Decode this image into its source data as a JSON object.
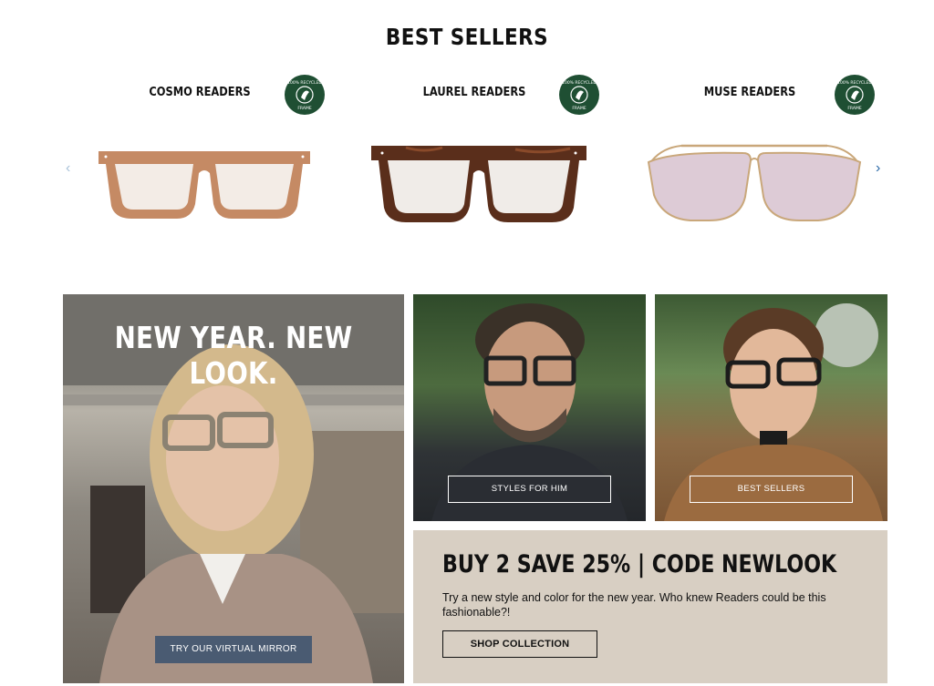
{
  "section": {
    "title": "BEST SELLERS"
  },
  "carousel": {
    "products": [
      {
        "name": "COSMO READERS",
        "badge": "100% RECYCLED FRAME",
        "frame_color": "#c58a64",
        "lens_color": "#f3ece6"
      },
      {
        "name": "LAUREL READERS",
        "badge": "100% RECYCLED FRAME",
        "frame_color": "#5a2e1b",
        "lens_color": "#f0ece8"
      },
      {
        "name": "MUSE READERS",
        "badge": "100% RECYCLED FRAME",
        "frame_color": "#c9a77a",
        "lens_color": "#ddcbd6"
      }
    ],
    "prev_icon": "chevron-left-icon",
    "next_icon": "chevron-right-icon"
  },
  "hero": {
    "heading": "NEW YEAR. NEW LOOK.",
    "button": "TRY OUR VIRTUAL MIRROR"
  },
  "him": {
    "button": "STYLES FOR HIM"
  },
  "best": {
    "button": "BEST SELLERS"
  },
  "promo": {
    "heading": "BUY 2 SAVE 25% | CODE NEWLOOK",
    "text": "Try a new style and color for the new year. Who knew Readers could be this fashionable?!",
    "button": "SHOP COLLECTION"
  },
  "colors": {
    "badge": "#1f4f33",
    "mirror_button": "#4a5b72",
    "promo_bg": "#d8cfc3"
  }
}
